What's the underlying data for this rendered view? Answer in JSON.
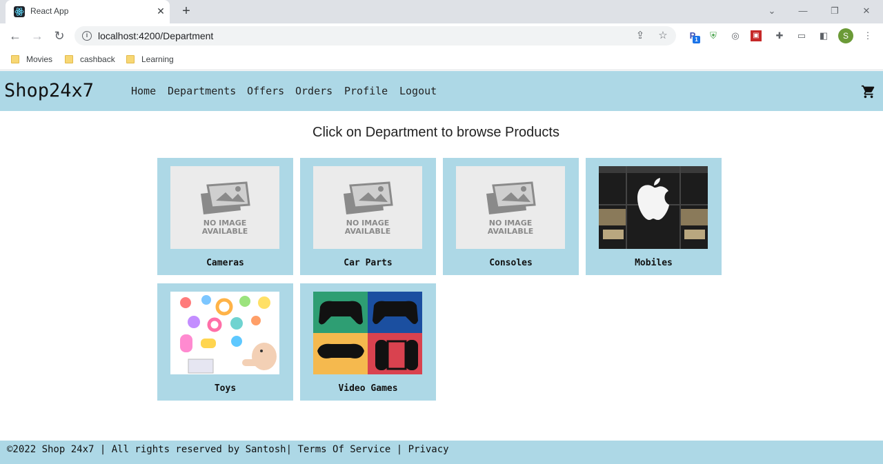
{
  "browser": {
    "tab_title": "React App",
    "url": "localhost:4200/Department",
    "profile_initial": "S",
    "extension_badge": "1",
    "bookmarks": [
      "Movies",
      "cashback",
      "Learning"
    ]
  },
  "app": {
    "brand": "Shop24x7",
    "nav": [
      "Home",
      "Departments",
      "Offers",
      "Orders",
      "Profile",
      "Logout"
    ],
    "heading": "Click on Department to browse Products",
    "departments": [
      {
        "name": "Cameras",
        "image": "no-image-placeholder",
        "placeholder_text": "NO IMAGE AVAILABLE"
      },
      {
        "name": "Car Parts",
        "image": "no-image-placeholder",
        "placeholder_text": "NO IMAGE AVAILABLE"
      },
      {
        "name": "Consoles",
        "image": "no-image-placeholder",
        "placeholder_text": "NO IMAGE AVAILABLE"
      },
      {
        "name": "Mobiles",
        "image": "apple-store-photo"
      },
      {
        "name": "Toys",
        "image": "baby-toys-photo"
      },
      {
        "name": "Video Games",
        "image": "game-controllers-grid"
      }
    ],
    "footer": {
      "copyright": "©2022 Shop 24x7 | All rights reserved by Santosh",
      "terms": "Terms Of Service",
      "privacy": "Privacy"
    }
  },
  "colors": {
    "accent": "#add8e6"
  }
}
